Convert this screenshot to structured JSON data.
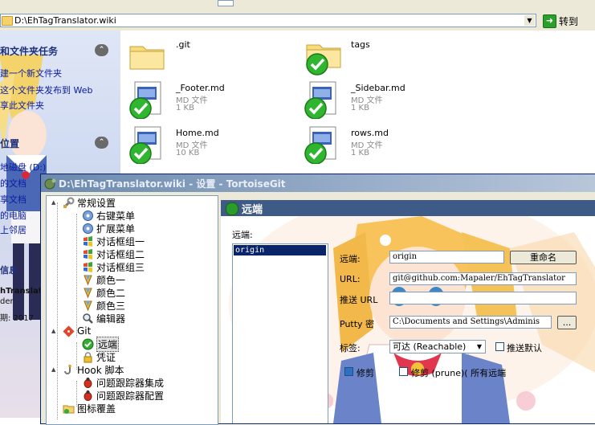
{
  "explorer": {
    "address": "D:\\EhTagTranslator.wiki",
    "go_label": "转到",
    "tasks": {
      "header1": "和文件夹任务",
      "items": [
        "建一个新文件夹",
        "这个文件夹发布到 Web",
        "享此文件夹"
      ],
      "header2": "位置",
      "places": [
        "地磁盘 (D:)",
        "的文档",
        "享文档",
        "的电脑",
        "上邻居"
      ],
      "detail_header": "信息",
      "detail_lines": [
        "hTranslat",
        "der",
        "期: 2017"
      ]
    },
    "files": [
      {
        "name": ".git",
        "type": "",
        "size": "",
        "icon": "folder-icon"
      },
      {
        "name": "tags",
        "type": "",
        "size": "",
        "icon": "folder-synced-icon"
      },
      {
        "name": "_Footer.md",
        "type": "MD 文件",
        "size": "1 KB",
        "icon": "md-file-synced-icon"
      },
      {
        "name": "_Sidebar.md",
        "type": "MD 文件",
        "size": "1 KB",
        "icon": "md-file-synced-icon"
      },
      {
        "name": "Home.md",
        "type": "MD 文件",
        "size": "10 KB",
        "icon": "md-file-synced-icon"
      },
      {
        "name": "rows.md",
        "type": "MD 文件",
        "size": "1 KB",
        "icon": "md-file-synced-icon"
      }
    ]
  },
  "dialog": {
    "title": "D:\\EhTagTranslator.wiki - 设置 - TortoiseGit",
    "tree": [
      {
        "label": "常规设置",
        "icon": "wrench-icon"
      },
      {
        "label": "右键菜单",
        "icon": "gear-icon"
      },
      {
        "label": "扩展菜单",
        "icon": "gear-icon"
      },
      {
        "label": "对话框组一",
        "icon": "windows-flag-icon"
      },
      {
        "label": "对话框组二",
        "icon": "windows-flag-icon"
      },
      {
        "label": "对话框组三",
        "icon": "windows-flag-icon"
      },
      {
        "label": "颜色一",
        "icon": "color-brush-icon"
      },
      {
        "label": "颜色二",
        "icon": "color-brush-icon"
      },
      {
        "label": "颜色三",
        "icon": "color-brush-icon"
      },
      {
        "label": "编辑器",
        "icon": "magnifier-icon"
      },
      {
        "label": "Git",
        "icon": "git-icon"
      },
      {
        "label": "远端",
        "icon": "green-globe-icon"
      },
      {
        "label": "凭证",
        "icon": "lock-icon"
      },
      {
        "label": "Hook 脚本",
        "icon": "hook-icon"
      },
      {
        "label": "问题跟踪器集成",
        "icon": "bug-icon"
      },
      {
        "label": "问题跟踪器配置",
        "icon": "bug-icon"
      },
      {
        "label": "图标覆盖",
        "icon": "overlay-icon"
      }
    ],
    "page_title": "远端",
    "remote_label": "远端:",
    "remotes": [
      "origin"
    ],
    "fields": {
      "remote_name_label": "远端:",
      "remote_name_value": "origin",
      "rename_button": "重命名",
      "url_label": "URL:",
      "url_value": "git@github.com:Mapaler/EhTagTranslator",
      "push_url_label": "推送 URL",
      "push_url_value": "",
      "putty_label": "Putty 密",
      "putty_value": "C:\\Documents and Settings\\Adminis",
      "browse_button": "...",
      "tags_label": "标签:",
      "tags_value": "可达 (Reachable)",
      "push_default_label": "推送默认",
      "prune_label": "修剪",
      "prune_all_label": "修剪 (prune)( 所有远端"
    }
  }
}
